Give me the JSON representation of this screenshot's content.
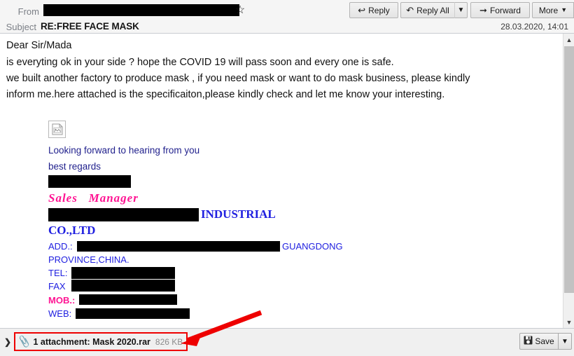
{
  "header": {
    "from_label": "From",
    "from_value_redacted": true,
    "star_icon": "star-outline-icon",
    "subject_label": "Subject",
    "subject_value": "RE:FREE FACE MASK",
    "date": "28.03.2020, 14:01"
  },
  "toolbar": {
    "reply_label": "Reply",
    "reply_icon": "reply-arrow-icon",
    "reply_all_label": "Reply All",
    "reply_all_icon": "reply-all-arrow-icon",
    "reply_all_dropdown_icon": "chevron-down-icon",
    "forward_label": "Forward",
    "forward_icon": "forward-arrow-icon",
    "more_label": "More",
    "more_dropdown_icon": "chevron-down-icon"
  },
  "body": {
    "paragraphs": [
      "Dear Sir/Mada",
      "is everyting ok in your side ? hope the COVID 19 will pass soon and every one is safe.",
      "we built another  factory to produce mask , if you need mask or want to do mask business, please kindly",
      "inform me.here attached is the specificaiton,please kindly check and let me know your interesting."
    ],
    "signature": {
      "broken_image_icon": "broken-image-icon",
      "closing_line": "Looking forward to hearing from you",
      "regards_line": "best regards",
      "name_redacted": true,
      "job_title": "Sales   Manager",
      "company_redacted": true,
      "company_suffix": "INDUSTRIAL",
      "company_suffix2": "CO.,LTD",
      "address_label": "ADD.:",
      "address_redacted": true,
      "address_region": "GUANGDONG",
      "address_line2": "PROVINCE,CHINA.",
      "tel_label": "TEL:",
      "tel_redacted": true,
      "fax_label": "FAX",
      "fax_redacted": true,
      "mob_label": "MOB.:",
      "mob_redacted": true,
      "web_label": "WEB:",
      "web_redacted": true
    }
  },
  "scrollbar": {
    "up_arrow_icon": "chevron-up-icon",
    "down_arrow_icon": "chevron-down-icon"
  },
  "attachment_bar": {
    "expand_icon": "chevron-right-icon",
    "clip_icon": "paperclip-icon",
    "text": "1 attachment: Mask 2020.rar",
    "size": "826 KB",
    "save_label": "Save",
    "save_icon": "save-disk-icon",
    "save_dropdown_icon": "chevron-down-icon"
  },
  "annotations": {
    "highlight_color": "#ee0000",
    "arrow_icon": "red-arrow-annotation"
  },
  "colors": {
    "signature_blue": "#1f1f8c",
    "company_blue": "#2020e0",
    "magenta": "#ff1493",
    "annotation_red": "#ee0000",
    "header_bg": "#f5f5f5"
  }
}
